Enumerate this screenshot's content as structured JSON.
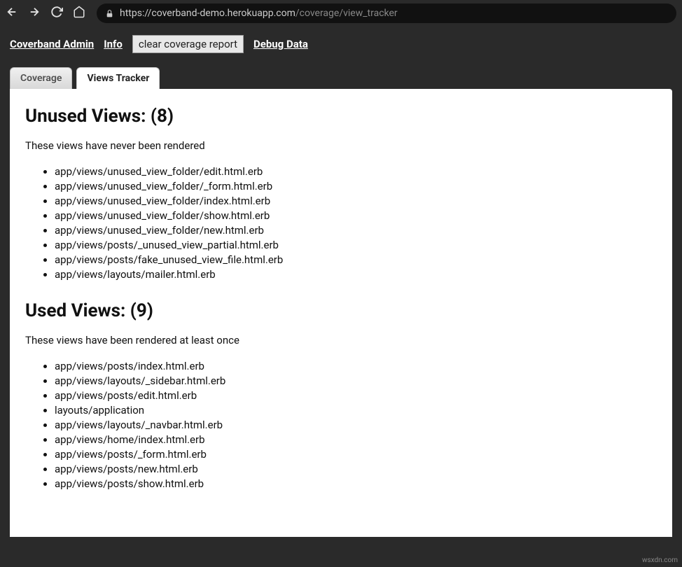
{
  "browser": {
    "url_host": "https://coverband-demo.herokuapp.com",
    "url_path": "/coverage/view_tracker"
  },
  "header": {
    "admin_link": "Coverband Admin",
    "info_link": "Info",
    "clear_button": "clear coverage report",
    "debug_link": "Debug Data"
  },
  "tabs": {
    "coverage": "Coverage",
    "views_tracker": "Views Tracker"
  },
  "unused": {
    "heading": "Unused Views: (8)",
    "description": "These views have never been rendered",
    "items": [
      "app/views/unused_view_folder/edit.html.erb",
      "app/views/unused_view_folder/_form.html.erb",
      "app/views/unused_view_folder/index.html.erb",
      "app/views/unused_view_folder/show.html.erb",
      "app/views/unused_view_folder/new.html.erb",
      "app/views/posts/_unused_view_partial.html.erb",
      "app/views/posts/fake_unused_view_file.html.erb",
      "app/views/layouts/mailer.html.erb"
    ]
  },
  "used": {
    "heading": "Used Views: (9)",
    "description": "These views have been rendered at least once",
    "items": [
      "app/views/posts/index.html.erb",
      "app/views/layouts/_sidebar.html.erb",
      "app/views/posts/edit.html.erb",
      "layouts/application",
      "app/views/layouts/_navbar.html.erb",
      "app/views/home/index.html.erb",
      "app/views/posts/_form.html.erb",
      "app/views/posts/new.html.erb",
      "app/views/posts/show.html.erb"
    ]
  },
  "watermark": "wsxdn.com"
}
